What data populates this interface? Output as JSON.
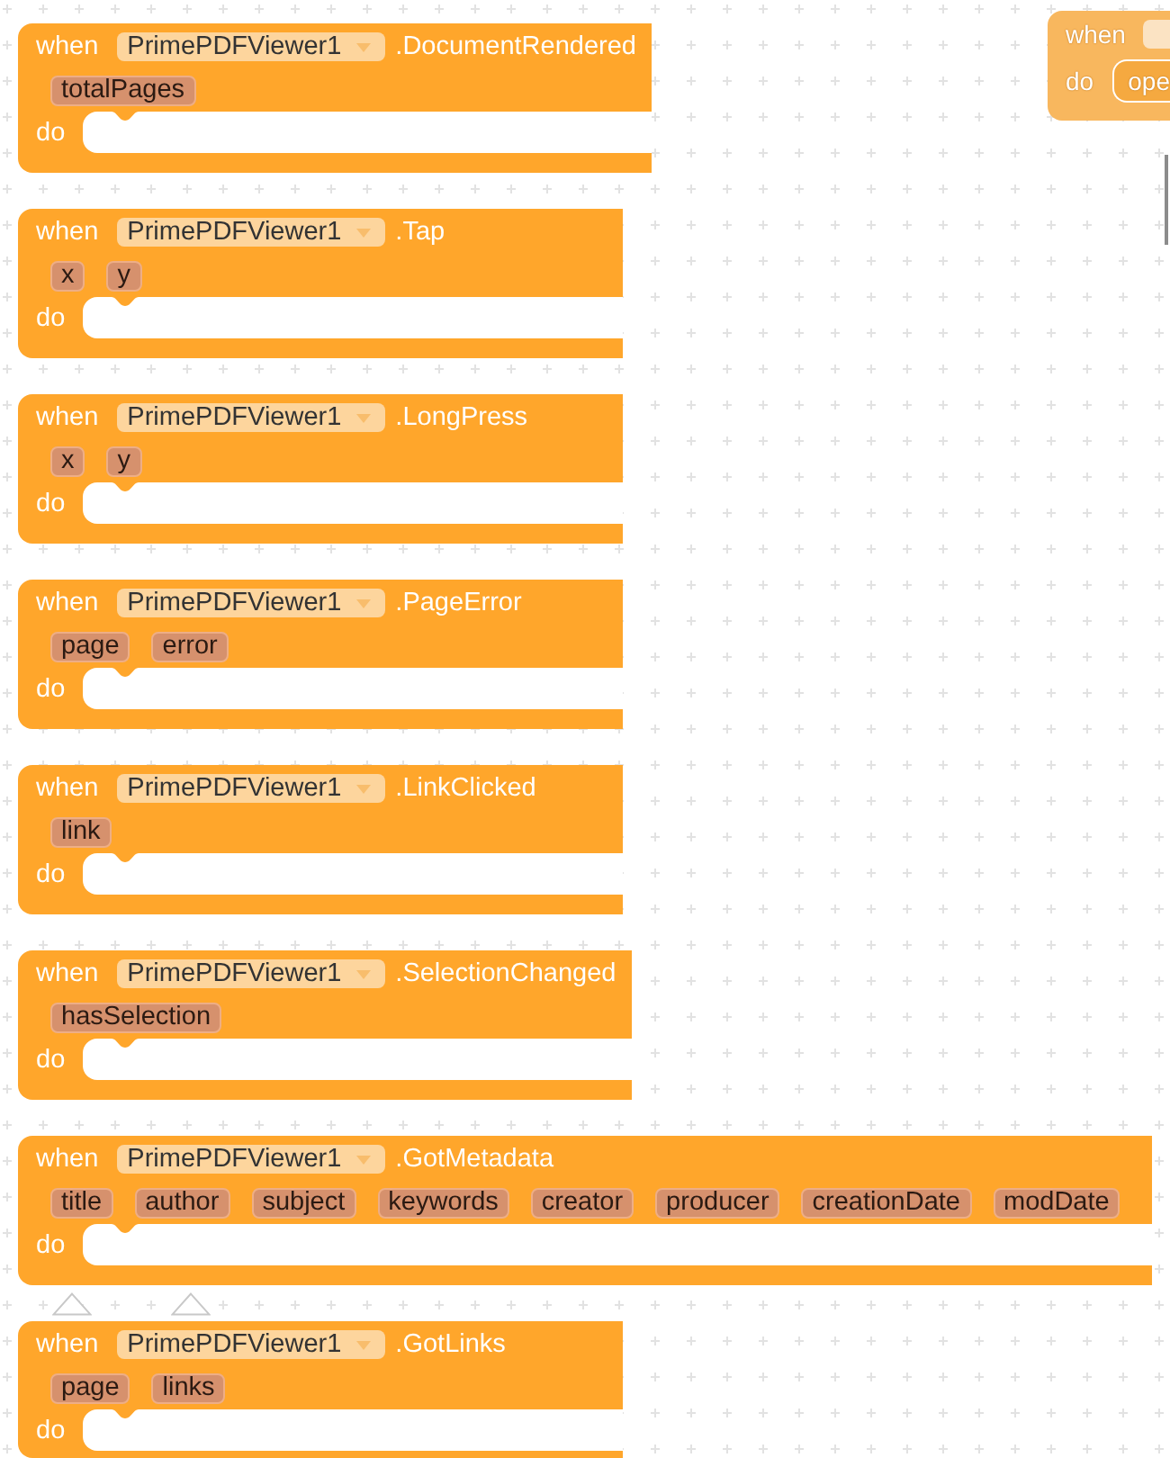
{
  "faded_block": {
    "when": "when",
    "do": "do",
    "statement": "ope"
  },
  "blocks": [
    {
      "when": "when",
      "component": "PrimePDFViewer1",
      "event": ".DocumentRendered",
      "params": [
        "totalPages"
      ],
      "do": "do"
    },
    {
      "when": "when",
      "component": "PrimePDFViewer1",
      "event": ".Tap",
      "params": [
        "x",
        "y"
      ],
      "do": "do"
    },
    {
      "when": "when",
      "component": "PrimePDFViewer1",
      "event": ".LongPress",
      "params": [
        "x",
        "y"
      ],
      "do": "do"
    },
    {
      "when": "when",
      "component": "PrimePDFViewer1",
      "event": ".PageError",
      "params": [
        "page",
        "error"
      ],
      "do": "do"
    },
    {
      "when": "when",
      "component": "PrimePDFViewer1",
      "event": ".LinkClicked",
      "params": [
        "link"
      ],
      "do": "do"
    },
    {
      "when": "when",
      "component": "PrimePDFViewer1",
      "event": ".SelectionChanged",
      "params": [
        "hasSelection"
      ],
      "do": "do"
    },
    {
      "when": "when",
      "component": "PrimePDFViewer1",
      "event": ".GotMetadata",
      "params": [
        "title",
        "author",
        "subject",
        "keywords",
        "creator",
        "producer",
        "creationDate",
        "modDate"
      ],
      "do": "do"
    },
    {
      "when": "when",
      "component": "PrimePDFViewer1",
      "event": ".GotLinks",
      "params": [
        "page",
        "links"
      ],
      "do": "do"
    }
  ]
}
